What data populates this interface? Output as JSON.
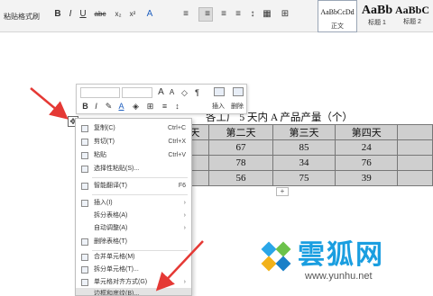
{
  "ribbon": {
    "format_painter": "格式刷",
    "bold": "B",
    "italic": "I",
    "underline": "U",
    "strike": "abc",
    "sub": "x₂",
    "sup": "x²",
    "text_effects": "A",
    "styles": [
      {
        "preview": "AaBbCcDd",
        "label": "正文"
      },
      {
        "preview": "AaBb",
        "label": "标题 1"
      },
      {
        "preview": "AaBbC",
        "label": "标题 2"
      },
      {
        "preview": "AaBbC",
        "label": "标"
      }
    ]
  },
  "mini_toolbar": {
    "grow_font": "A",
    "shrink_font": "A",
    "bold": "B",
    "italic": "I",
    "align": "≡",
    "insert_label": "插入",
    "delete_label": "删除"
  },
  "document": {
    "title": "各工厂 5 天内 A 产品产量（个）",
    "table": {
      "rows": [
        [
          "天",
          "第二天",
          "第三天",
          "第四天",
          ""
        ],
        [
          "",
          "67",
          "85",
          "24",
          ""
        ],
        [
          "",
          "78",
          "34",
          "76",
          ""
        ],
        [
          "",
          "56",
          "75",
          "39",
          ""
        ]
      ]
    },
    "add_row": "+"
  },
  "context_menu": {
    "items": [
      {
        "label": "复制(C)",
        "shortcut": "Ctrl+C"
      },
      {
        "label": "剪切(T)",
        "shortcut": "Ctrl+X"
      },
      {
        "label": "粘贴",
        "shortcut": "Ctrl+V"
      },
      {
        "label": "选择性粘贴(S)...",
        "shortcut": ""
      },
      {
        "label": "智能翻译(T)",
        "shortcut": "F6"
      },
      {
        "label": "插入(I)",
        "shortcut": ""
      },
      {
        "label": "拆分表格(A)",
        "shortcut": ""
      },
      {
        "label": "自动调整(A)",
        "shortcut": ""
      },
      {
        "label": "删除表格(T)",
        "shortcut": ""
      },
      {
        "label": "合并单元格(M)",
        "shortcut": ""
      },
      {
        "label": "拆分单元格(T)...",
        "shortcut": ""
      },
      {
        "label": "单元格对齐方式(G)",
        "shortcut": ""
      },
      {
        "label": "边框和底纹(B)...",
        "shortcut": ""
      }
    ]
  },
  "watermark": {
    "text": "雲狐网",
    "url": "www.yunhu.net"
  },
  "colors": {
    "arrow": "#e53935",
    "watermark_blue": "#1a9ee0",
    "table_fill": "#cfcfcf"
  }
}
